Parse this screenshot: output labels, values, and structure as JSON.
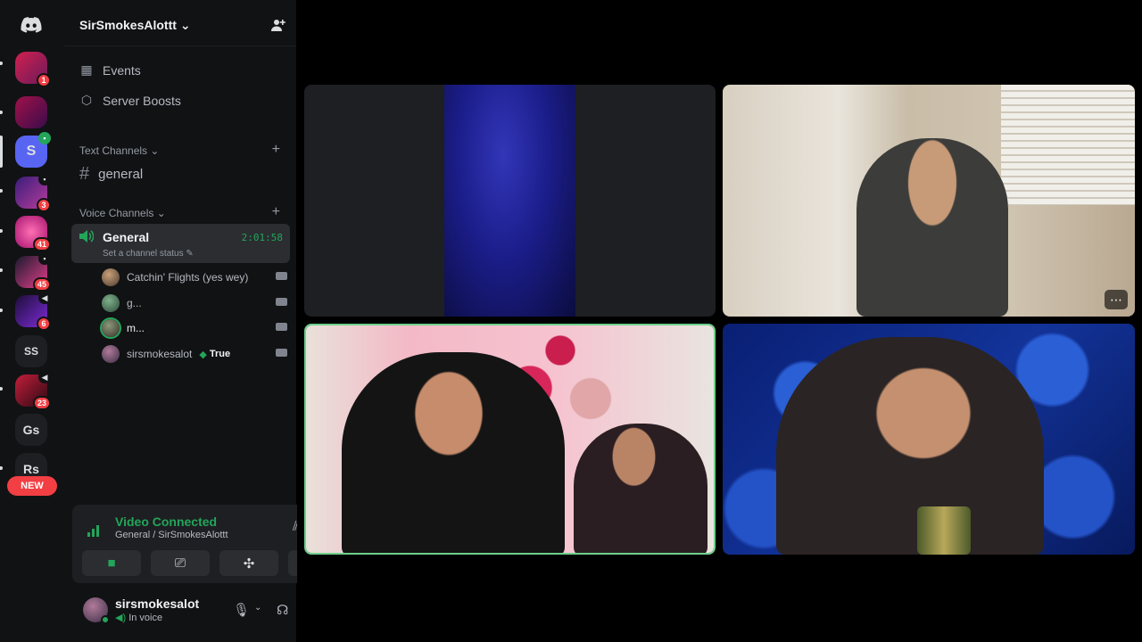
{
  "server": {
    "name": "SirSmokesAlottt",
    "name_caret": "⌄",
    "invite_icon": "person-add-icon"
  },
  "rail": {
    "home_icon": "discord-logo-icon",
    "servers": [
      {
        "badge": "1"
      },
      {
        "badge": ""
      },
      {
        "label": "S",
        "active": true
      },
      {
        "badge": "3"
      },
      {
        "badge": "41"
      },
      {
        "badge": "45"
      },
      {
        "badge": "6"
      },
      {
        "label": "SS"
      },
      {
        "badge": "23"
      },
      {
        "label": "Gs"
      },
      {
        "label": "Rs"
      }
    ],
    "new_label": "NEW"
  },
  "nav": {
    "events": "Events",
    "boosts": "Server Boosts"
  },
  "text_channels": {
    "header": "Text Channels",
    "channels": [
      "general"
    ]
  },
  "voice_channels": {
    "header": "Voice Channels",
    "active": {
      "name": "General",
      "time": "2:01:58",
      "status": "Set a channel status"
    },
    "members": [
      {
        "name": "Catchin' Flights (yes wey)"
      },
      {
        "name": "g..."
      },
      {
        "name": "m..."
      },
      {
        "name": "sirsmokesalot",
        "tag": "True"
      }
    ]
  },
  "voice_panel": {
    "title": "Video Connected",
    "subtitle": "General / SirSmokesAlottt"
  },
  "user": {
    "name": "sirsmokesalot",
    "status": "In voice"
  },
  "colors": {
    "accent_green": "#23a55a",
    "danger_red": "#f23f43",
    "blurple": "#5865f2"
  }
}
